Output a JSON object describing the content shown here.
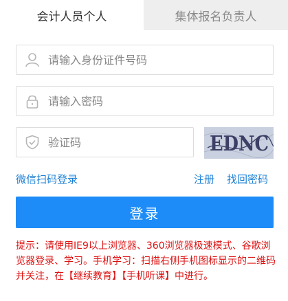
{
  "tabs": {
    "personal": "会计人员个人",
    "group": "集体报名负责人"
  },
  "form": {
    "username_placeholder": "请输入身份证件号码",
    "password_placeholder": "请输入密码",
    "captcha_placeholder": "验证码",
    "captcha_text": "EDNC"
  },
  "links": {
    "wechat_login": "微信扫码登录",
    "register": "注册",
    "forgot_password": "找回密码"
  },
  "buttons": {
    "login": "登录"
  },
  "tip": "提示：请使用IE9以上浏览器、360浏览器极速模式、谷歌浏览器登录、学习。手机学习：扫描右侧手机图标显示的二维码并关注，在【继续教育】【手机听课】中进行。",
  "colors": {
    "primary": "#1d8cf8",
    "link": "#1a7fd6",
    "tip": "#dd1111",
    "inactive_tab_bg": "#eeeeee"
  },
  "icons": {
    "username": "user-icon",
    "password": "lock-icon",
    "captcha": "shield-icon"
  }
}
